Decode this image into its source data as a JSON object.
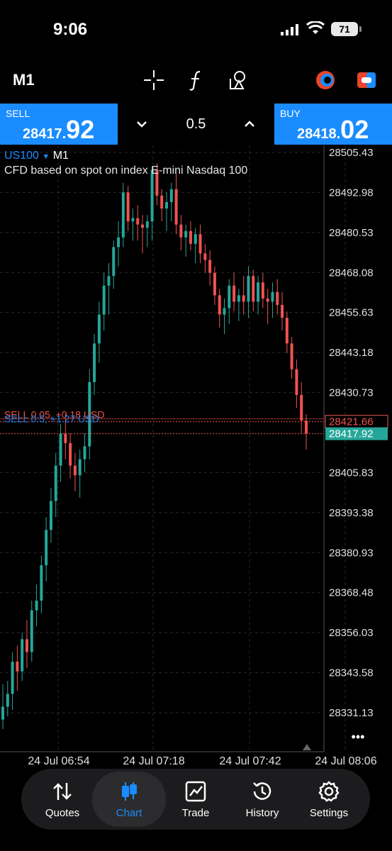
{
  "status_bar": {
    "time": "9:06",
    "battery": "71"
  },
  "toolbar": {
    "timeframe": "M1"
  },
  "trade": {
    "sell_label": "SELL",
    "sell_price_small": "28417.",
    "sell_price_large": "92",
    "volume": "0.5",
    "buy_label": "BUY",
    "buy_price_small": "28418.",
    "buy_price_large": "02"
  },
  "chart": {
    "symbol": "US100",
    "symbol_arrow": "▼",
    "timeframe": "M1",
    "description": "CFD based on spot on index E-mini Nasdaq 100",
    "sell_line_label": "SELL 0.05, +0.18 USD",
    "sell_line_label2": "SELL 0.5, +1.27 USD",
    "ask_price_tag": "28421.66",
    "bid_price_tag": "28417.92",
    "more_dots": "•••"
  },
  "chart_data": {
    "type": "candlestick",
    "y_ticks": [
      "28505.43",
      "28492.98",
      "28480.53",
      "28468.08",
      "28455.63",
      "28443.18",
      "28430.73",
      "28405.83",
      "28393.38",
      "28380.93",
      "28368.48",
      "28356.03",
      "28343.58",
      "28331.13"
    ],
    "x_ticks": [
      "24 Jul 06:54",
      "24 Jul 07:18",
      "24 Jul 07:42",
      "24 Jul 08:06"
    ],
    "ylim": [
      28325,
      28508
    ],
    "ask": 28421.66,
    "bid": 28417.92,
    "colors": {
      "up": "#26a69a",
      "down": "#ef5350",
      "ask_line": "#ef5350",
      "bid_line": "#ef5350",
      "sell_label": "#ef5350",
      "profit_label": "#1a8cff",
      "bid_tag": "#26a69a"
    },
    "candles": [
      [
        28329,
        28340,
        28326,
        28333
      ],
      [
        28333,
        28341,
        28330,
        28337
      ],
      [
        28337,
        28350,
        28332,
        28347
      ],
      [
        28347,
        28352,
        28338,
        28344
      ],
      [
        28344,
        28356,
        28341,
        28354
      ],
      [
        28354,
        28360,
        28345,
        28350
      ],
      [
        28350,
        28366,
        28347,
        28363
      ],
      [
        28363,
        28371,
        28358,
        28366
      ],
      [
        28366,
        28380,
        28362,
        28377
      ],
      [
        28377,
        28392,
        28372,
        28388
      ],
      [
        28388,
        28401,
        28384,
        28397
      ],
      [
        28397,
        28412,
        28392,
        28408
      ],
      [
        28408,
        28421,
        28403,
        28418
      ],
      [
        28418,
        28424,
        28410,
        28415
      ],
      [
        28415,
        28418,
        28404,
        28408
      ],
      [
        28408,
        28412,
        28400,
        28405
      ],
      [
        28405,
        28413,
        28398,
        28410
      ],
      [
        28410,
        28418,
        28406,
        28414
      ],
      [
        28414,
        28438,
        28410,
        28434
      ],
      [
        28434,
        28449,
        28430,
        28446
      ],
      [
        28446,
        28459,
        28440,
        28455
      ],
      [
        28455,
        28468,
        28450,
        28464
      ],
      [
        28464,
        28471,
        28455,
        28467
      ],
      [
        28467,
        28478,
        28463,
        28476
      ],
      [
        28476,
        28484,
        28470,
        28479
      ],
      [
        28479,
        28496,
        28476,
        28493
      ],
      [
        28493,
        28495,
        28481,
        28484
      ],
      [
        28484,
        28488,
        28478,
        28485
      ],
      [
        28485,
        28489,
        28478,
        28483
      ],
      [
        28483,
        28486,
        28474,
        28482
      ],
      [
        28482,
        28486,
        28476,
        28484
      ],
      [
        28484,
        28501,
        28478,
        28500
      ],
      [
        28500,
        28502,
        28489,
        28492
      ],
      [
        28492,
        28494,
        28484,
        28488
      ],
      [
        28488,
        28493,
        28481,
        28490
      ],
      [
        28490,
        28496,
        28484,
        28494
      ],
      [
        28494,
        28499,
        28480,
        28483
      ],
      [
        28483,
        28486,
        28475,
        28479
      ],
      [
        28479,
        28483,
        28473,
        28481
      ],
      [
        28481,
        28484,
        28475,
        28477
      ],
      [
        28477,
        28482,
        28471,
        28480
      ],
      [
        28480,
        28483,
        28471,
        28474
      ],
      [
        28474,
        28477,
        28468,
        28472
      ],
      [
        28472,
        28475,
        28464,
        28468
      ],
      [
        28468,
        28470,
        28458,
        28461
      ],
      [
        28461,
        28463,
        28451,
        28455
      ],
      [
        28455,
        28460,
        28449,
        28457
      ],
      [
        28457,
        28466,
        28452,
        28464
      ],
      [
        28464,
        28468,
        28456,
        28459
      ],
      [
        28459,
        28463,
        28453,
        28461
      ],
      [
        28461,
        28467,
        28455,
        28459
      ],
      [
        28459,
        28470,
        28454,
        28467
      ],
      [
        28467,
        28469,
        28456,
        28459
      ],
      [
        28459,
        28467,
        28455,
        28465
      ],
      [
        28465,
        28468,
        28457,
        28460
      ],
      [
        28460,
        28463,
        28452,
        28459
      ],
      [
        28459,
        28465,
        28454,
        28462
      ],
      [
        28462,
        28466,
        28455,
        28458
      ],
      [
        28458,
        28462,
        28450,
        28454
      ],
      [
        28454,
        28456,
        28443,
        28446
      ],
      [
        28446,
        28448,
        28435,
        28438
      ],
      [
        28438,
        28441,
        28426,
        28430
      ],
      [
        28430,
        28434,
        28418,
        28422
      ],
      [
        28422,
        28424,
        28413,
        28418
      ]
    ]
  },
  "nav": {
    "items": [
      {
        "label": "Quotes",
        "icon": "quotes-arrows-icon"
      },
      {
        "label": "Chart",
        "icon": "candles-icon"
      },
      {
        "label": "Trade",
        "icon": "trade-chart-icon"
      },
      {
        "label": "History",
        "icon": "history-clock-icon"
      },
      {
        "label": "Settings",
        "icon": "settings-gear-icon"
      }
    ]
  }
}
